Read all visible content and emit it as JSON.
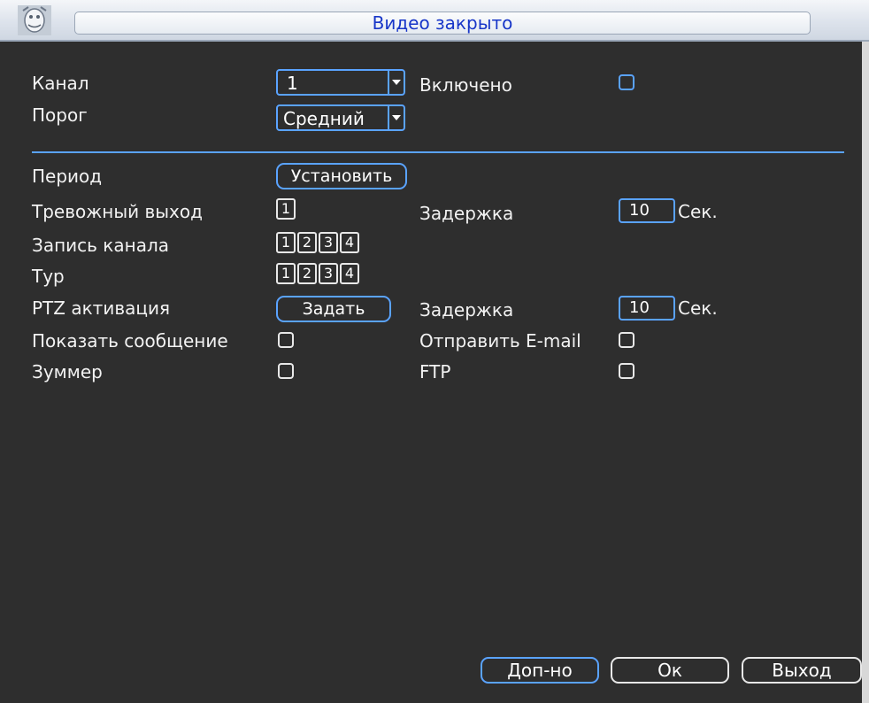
{
  "window": {
    "title": "Видео закрыто",
    "icon": "app-badge-icon"
  },
  "settings": {
    "channel": {
      "label": "Канал",
      "value": "1"
    },
    "enabled": {
      "label": "Включено",
      "checked": false
    },
    "threshold": {
      "label": "Порог",
      "value": "Средний"
    }
  },
  "actions": {
    "period": {
      "label": "Период",
      "button": "Установить"
    },
    "alarm_output": {
      "label": "Тревожный выход",
      "channels": [
        "1"
      ]
    },
    "delay1": {
      "label": "Задержка",
      "value": "10",
      "unit": "Сек."
    },
    "record_channel": {
      "label": "Запись канала",
      "channels": [
        "1",
        "2",
        "3",
        "4"
      ]
    },
    "tour": {
      "label": "Тур",
      "channels": [
        "1",
        "2",
        "3",
        "4"
      ]
    },
    "ptz": {
      "label": "PTZ активация",
      "button": "Задать"
    },
    "delay2": {
      "label": "Задержка",
      "value": "10",
      "unit": "Сек."
    },
    "show_message": {
      "label": "Показать сообщение",
      "checked": false
    },
    "send_email": {
      "label": "Отправить E-mail",
      "checked": false
    },
    "buzzer": {
      "label": "Зуммер",
      "checked": false
    },
    "ftp": {
      "label": "FTP",
      "checked": false
    }
  },
  "footer": {
    "advanced": "Доп-но",
    "ok": "Ок",
    "exit": "Выход"
  },
  "colors": {
    "accent": "#5aa3ff",
    "title_text": "#1836c8",
    "background": "#2e2e2e"
  }
}
